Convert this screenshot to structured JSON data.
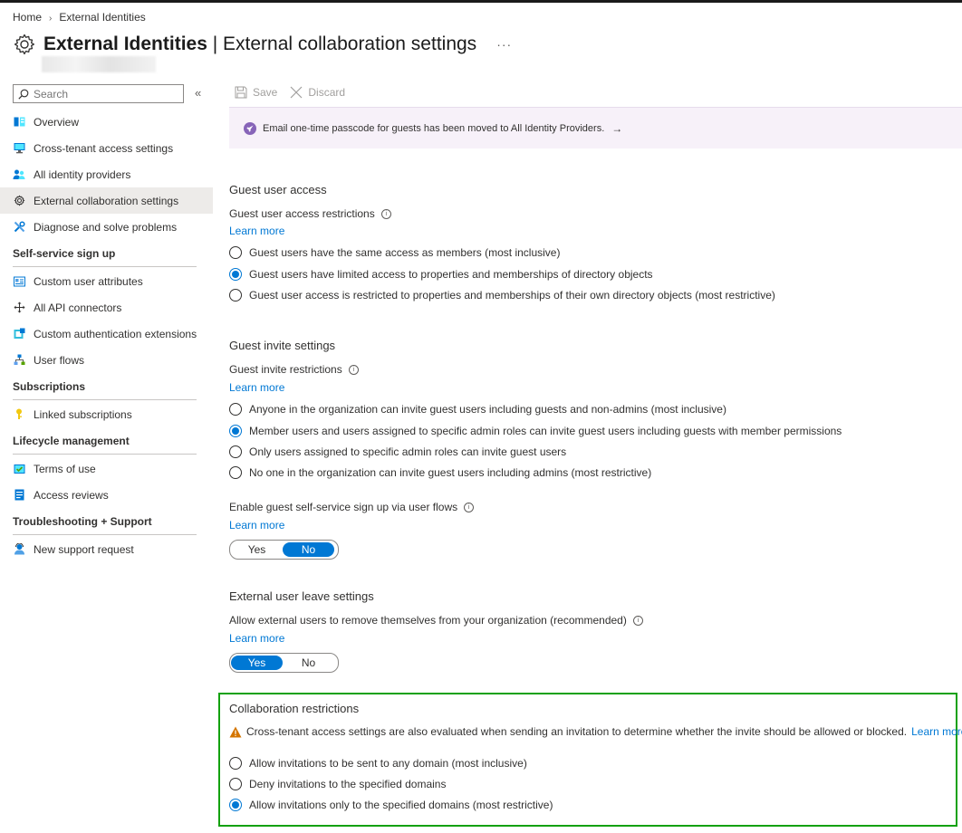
{
  "breadcrumb": {
    "home": "Home",
    "current": "External Identities"
  },
  "header": {
    "title": "External Identities",
    "subtitle": "| External collaboration settings",
    "more": "···"
  },
  "sidebar": {
    "search_placeholder": "Search",
    "collapse": "«",
    "items": [
      {
        "label": "Overview",
        "icon": "overview-icon"
      },
      {
        "label": "Cross-tenant access settings",
        "icon": "cross-tenant-icon"
      },
      {
        "label": "All identity providers",
        "icon": "identity-providers-icon"
      },
      {
        "label": "External collaboration settings",
        "icon": "gear-icon",
        "active": true
      },
      {
        "label": "Diagnose and solve problems",
        "icon": "wrench-icon"
      }
    ],
    "sections": [
      {
        "title": "Self-service sign up",
        "items": [
          {
            "label": "Custom user attributes",
            "icon": "attributes-icon"
          },
          {
            "label": "All API connectors",
            "icon": "api-connectors-icon"
          },
          {
            "label": "Custom authentication extensions",
            "icon": "extensions-icon"
          },
          {
            "label": "User flows",
            "icon": "user-flows-icon"
          }
        ]
      },
      {
        "title": "Subscriptions",
        "items": [
          {
            "label": "Linked subscriptions",
            "icon": "key-icon"
          }
        ]
      },
      {
        "title": "Lifecycle management",
        "items": [
          {
            "label": "Terms of use",
            "icon": "terms-icon"
          },
          {
            "label": "Access reviews",
            "icon": "access-reviews-icon"
          }
        ]
      },
      {
        "title": "Troubleshooting + Support",
        "items": [
          {
            "label": "New support request",
            "icon": "support-icon"
          }
        ]
      }
    ]
  },
  "toolbar": {
    "save": "Save",
    "discard": "Discard"
  },
  "banner": {
    "text": "Email one-time passcode for guests has been moved to All Identity Providers.",
    "arrow": "→"
  },
  "guest_access": {
    "title": "Guest user access",
    "label": "Guest user access restrictions",
    "learn_more": "Learn more",
    "options": [
      "Guest users have the same access as members (most inclusive)",
      "Guest users have limited access to properties and memberships of directory objects",
      "Guest user access is restricted to properties and memberships of their own directory objects (most restrictive)"
    ],
    "selected": 1
  },
  "guest_invite": {
    "title": "Guest invite settings",
    "label": "Guest invite restrictions",
    "learn_more": "Learn more",
    "options": [
      "Anyone in the organization can invite guest users including guests and non-admins (most inclusive)",
      "Member users and users assigned to specific admin roles can invite guest users including guests with member permissions",
      "Only users assigned to specific admin roles can invite guest users",
      "No one in the organization can invite guest users including admins (most restrictive)"
    ],
    "selected": 1,
    "self_service_label": "Enable guest self-service sign up via user flows",
    "self_service_learn_more": "Learn more",
    "self_service_toggle": {
      "yes": "Yes",
      "no": "No",
      "value": "No"
    }
  },
  "leave": {
    "title": "External user leave settings",
    "label": "Allow external users to remove themselves from your organization (recommended)",
    "learn_more": "Learn more",
    "toggle": {
      "yes": "Yes",
      "no": "No",
      "value": "Yes"
    }
  },
  "collab": {
    "title": "Collaboration restrictions",
    "warning": "Cross-tenant access settings are also evaluated when sending an invitation to determine whether the invite should be allowed or blocked.",
    "warning_link": "Learn more.",
    "options": [
      "Allow invitations to be sent to any domain (most inclusive)",
      "Deny invitations to the specified domains",
      "Allow invitations only to the specified domains (most restrictive)"
    ],
    "selected": 2
  },
  "colors": {
    "accent": "#0078d4",
    "highlight_border": "#13a10e",
    "warning": "#d47500",
    "banner_bg": "#f7f1f9"
  }
}
